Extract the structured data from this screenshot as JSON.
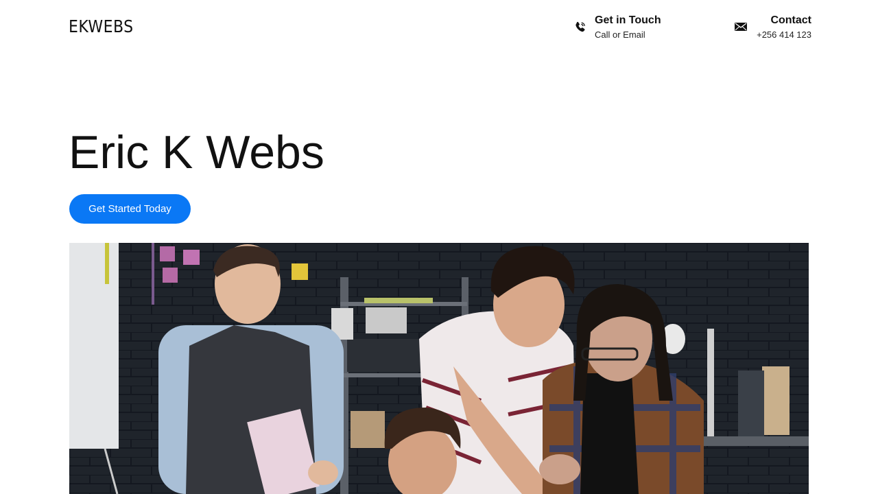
{
  "header": {
    "logo": "EKWEBS",
    "get_in_touch": {
      "icon": "phone-icon",
      "title": "Get in Touch",
      "subtitle": "Call or Email"
    },
    "contact": {
      "icon": "envelope-icon",
      "title": "Contact",
      "phone": "+256 414 123"
    }
  },
  "hero": {
    "title": "Eric K Webs",
    "cta_label": "Get Started Today",
    "cta_color": "#0a78f5"
  },
  "image": {
    "subject": "team-working-photo"
  }
}
